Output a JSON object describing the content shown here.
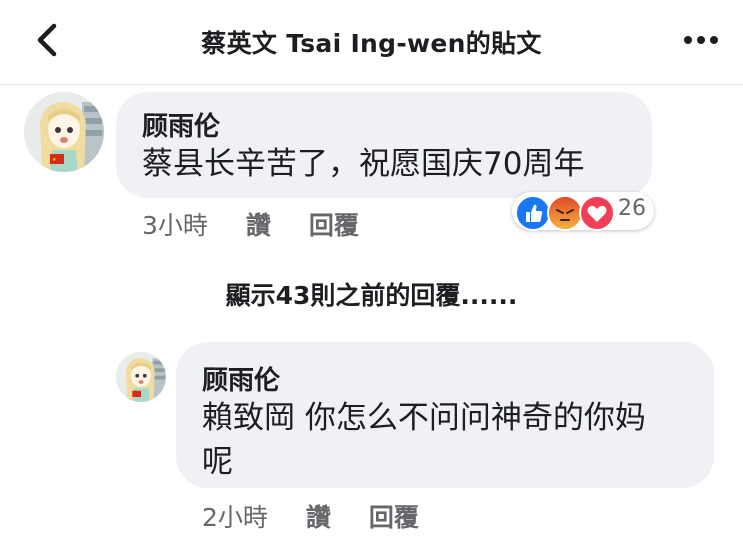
{
  "header": {
    "title": "蔡英文 Tsai Ing-wen的貼文"
  },
  "comments": [
    {
      "author": "顾雨伦",
      "text": "蔡县长辛苦了，祝愿国庆70周年",
      "time": "3小時",
      "like_label": "讚",
      "reply_label": "回覆",
      "reaction_count": "26",
      "reactions": [
        "like-icon",
        "angry-icon",
        "love-icon"
      ]
    }
  ],
  "show_previous": "顯示43則之前的回覆......",
  "reply": {
    "author": "顾雨伦",
    "text_line1": "賴致岡 你怎么不问问神奇的你妈",
    "text_line2": "呢",
    "time": "2小時",
    "like_label": "讚",
    "reply_label": "回覆"
  },
  "colors": {
    "bubble": "#eff1f4",
    "like_blue": "#1877f2",
    "angry_orange": "#f07b2a",
    "love_red": "#f33e58",
    "meta_gray": "#65676b"
  }
}
